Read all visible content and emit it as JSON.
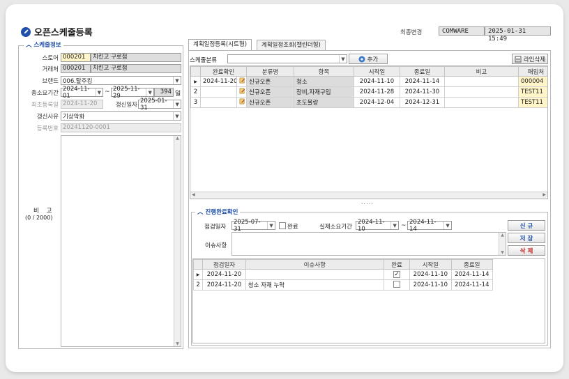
{
  "window": {
    "title": "오픈스케줄등록"
  },
  "header": {
    "last_modified_label": "최종변경",
    "user": "COMWARE",
    "datetime": "2025-01-31 15:49"
  },
  "left": {
    "group_title": "스케줄정보",
    "store_label": "스토어",
    "store_code": "000201",
    "store_name": "치킨고 구로점",
    "vendor_label": "거래처",
    "vendor_code": "000201",
    "vendor_name": "치킨고 구로점",
    "brand_label": "브랜드",
    "brand_value": "006.탈주킹",
    "period_label": "총소요기간",
    "period_start": "2024-11-01",
    "period_end": "2025-11-29",
    "period_days": "394",
    "period_unit": "일",
    "first_reg_label": "최초등록일",
    "first_reg_value": "2024-11-20",
    "renew_date_label": "갱신일자",
    "renew_date_value": "2025-01-31",
    "renew_reason_label": "갱신사유",
    "renew_reason_value": "기상악화",
    "reg_no_label": "등록번호",
    "reg_no_value": "20241120-0001",
    "memo_label": "비    고",
    "memo_count": "(0 / 2000)",
    "tilde": "~"
  },
  "tabs": [
    {
      "label": "계획일정등록(시트형)"
    },
    {
      "label": "계획일정조회(캘린더형)"
    }
  ],
  "schedule": {
    "category_label": "스케줄분류",
    "add_label": "추가",
    "delete_line_label": "라인삭제",
    "columns": [
      "완료확인",
      "분류명",
      "항목",
      "시작일",
      "종료일",
      "비고",
      "매입처"
    ],
    "rows": [
      {
        "num": "1",
        "done": "2024-11-20",
        "category": "신규오픈",
        "item": "청소",
        "start": "2024-11-10",
        "end": "2024-11-14",
        "note": "",
        "vendor": "000004"
      },
      {
        "num": "2",
        "done": "",
        "category": "신규오픈",
        "item": "장비,자재구입",
        "start": "2024-11-28",
        "end": "2024-11-30",
        "note": "",
        "vendor": "TEST11"
      },
      {
        "num": "3",
        "done": "",
        "category": "신규오픈",
        "item": "초도물량",
        "start": "2024-12-04",
        "end": "2024-12-31",
        "note": "",
        "vendor": "TEST11"
      }
    ],
    "splitter": "....."
  },
  "progress": {
    "group_title": "진행완료확인",
    "check_date_label": "점검일자",
    "check_date_value": "2025-07-31",
    "complete_label": "완료",
    "actual_period_label": "실제소요기간",
    "actual_start": "2024-11-10",
    "actual_end": "2024-11-14",
    "issue_label": "이슈사항",
    "new_label": "신 규",
    "save_label": "저 장",
    "delete_label": "삭 제",
    "tilde": "~",
    "columns": [
      "점검일자",
      "이슈사항",
      "완료",
      "시작일",
      "종료일"
    ],
    "rows": [
      {
        "num": "1",
        "date": "2024-11-20",
        "issue": "",
        "done": "✓",
        "start": "2024-11-10",
        "end": "2024-11-14"
      },
      {
        "num": "2",
        "date": "2024-11-20",
        "issue": "청소 자재 누락",
        "done": "",
        "start": "2024-11-10",
        "end": "2024-11-14"
      }
    ]
  }
}
